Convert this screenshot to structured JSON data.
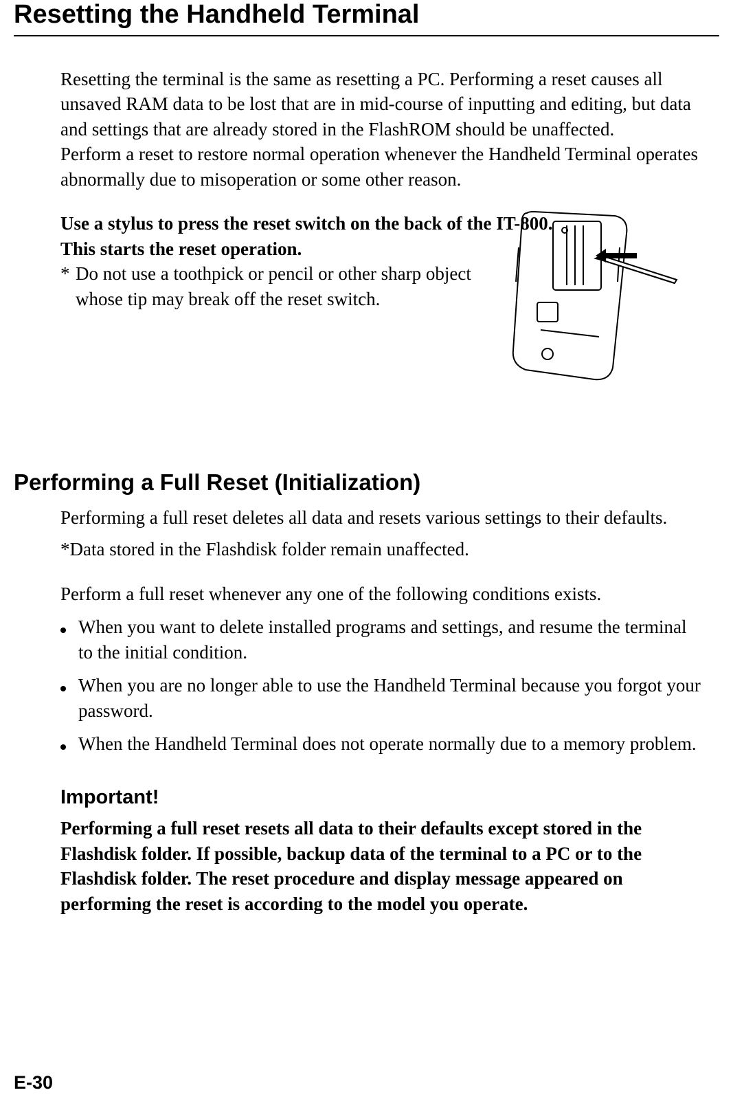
{
  "title": "Resetting the Handheld Terminal",
  "intro_p1": "Resetting the terminal is the same as resetting a PC. Performing a reset causes all unsaved RAM data to be lost that are in mid-course of inputting and editing, but data and settings that are already stored in the FlashROM should be unaffected.",
  "intro_p2": "Perform a reset to restore normal operation whenever the Handheld Terminal operates abnormally due to misoperation or some other reason.",
  "stylus_line1": "Use a stylus to press the reset switch on the back of the IT-800.",
  "stylus_line2": "This starts the reset operation.",
  "note_ast": "*",
  "note_text": "Do not use a toothpick or pencil or other sharp object whose tip may break off the reset switch.",
  "section2_title": "Performing a Full Reset (Initialization)",
  "section2_p1": "Performing a full reset deletes all data and resets various settings to their defaults.",
  "section2_p2": "*Data stored in the Flashdisk folder remain unaffected.",
  "section2_p3": "Perform a full reset whenever any one of the following conditions exists.",
  "bullets": [
    "When you want to delete installed programs and settings, and resume the terminal to the initial condition.",
    "When you are no longer able to use the Handheld Terminal because you forgot your password.",
    "When the Handheld Terminal does not operate normally due to a memory problem."
  ],
  "important_title": "Important!",
  "important_text": "Performing a full reset resets all data to their defaults except stored in the Flashdisk folder. If possible, backup data of the terminal to a PC or to the Flashdisk folder. The reset procedure and display message appeared on performing the reset is according to the model you operate.",
  "page_number": "E-30"
}
